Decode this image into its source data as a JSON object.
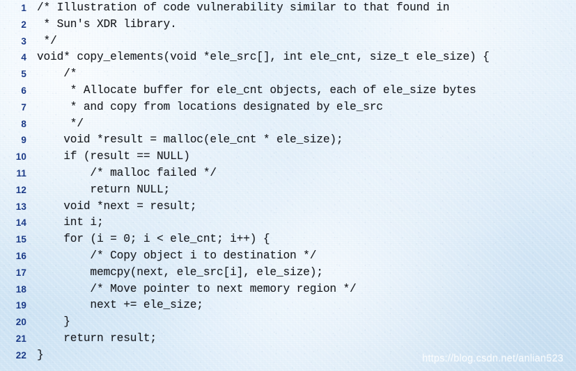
{
  "figure": {
    "kind": "code-listing",
    "language": "C",
    "background_color": "#dfeefa",
    "line_number_color": "#1b3a87",
    "code_color": "#17191d",
    "first_line_number": 1,
    "last_line_number": 22
  },
  "code": {
    "lines": [
      {
        "number": "1",
        "text": "/* Illustration of code vulnerability similar to that found in"
      },
      {
        "number": "2",
        "text": " * Sun's XDR library."
      },
      {
        "number": "3",
        "text": " */"
      },
      {
        "number": "4",
        "text": "void* copy_elements(void *ele_src[], int ele_cnt, size_t ele_size) {"
      },
      {
        "number": "5",
        "text": "    /*"
      },
      {
        "number": "6",
        "text": "     * Allocate buffer for ele_cnt objects, each of ele_size bytes"
      },
      {
        "number": "7",
        "text": "     * and copy from locations designated by ele_src"
      },
      {
        "number": "8",
        "text": "     */"
      },
      {
        "number": "9",
        "text": "    void *result = malloc(ele_cnt * ele_size);"
      },
      {
        "number": "10",
        "text": "    if (result == NULL)"
      },
      {
        "number": "11",
        "text": "        /* malloc failed */"
      },
      {
        "number": "12",
        "text": "        return NULL;"
      },
      {
        "number": "13",
        "text": "    void *next = result;"
      },
      {
        "number": "14",
        "text": "    int i;"
      },
      {
        "number": "15",
        "text": "    for (i = 0; i < ele_cnt; i++) {"
      },
      {
        "number": "16",
        "text": "        /* Copy object i to destination */"
      },
      {
        "number": "17",
        "text": "        memcpy(next, ele_src[i], ele_size);"
      },
      {
        "number": "18",
        "text": "        /* Move pointer to next memory region */"
      },
      {
        "number": "19",
        "text": "        next += ele_size;"
      },
      {
        "number": "20",
        "text": "    }"
      },
      {
        "number": "21",
        "text": "    return result;"
      },
      {
        "number": "22",
        "text": "}"
      }
    ]
  },
  "watermark": {
    "text": "https://blog.csdn.net/anlian523"
  }
}
